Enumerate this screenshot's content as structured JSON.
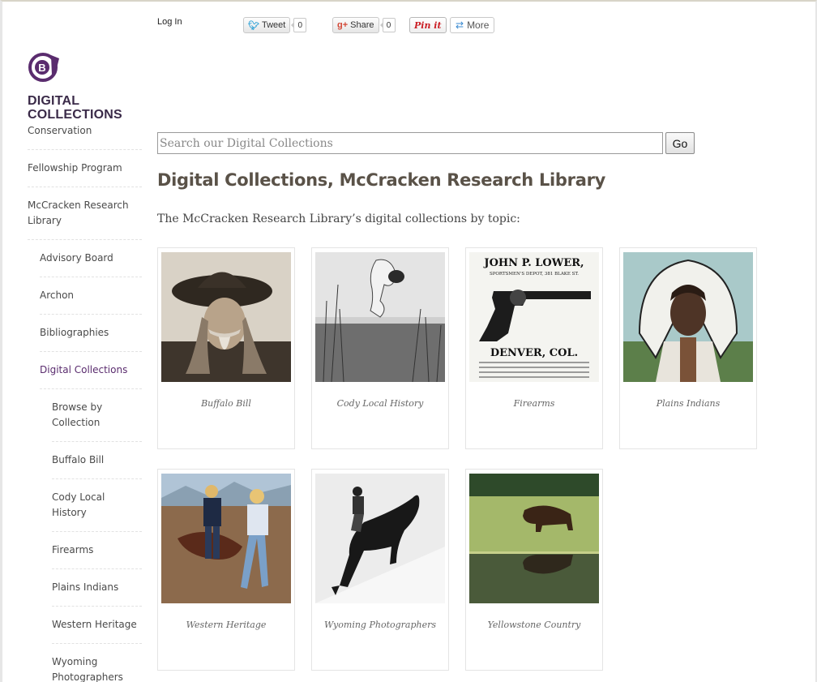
{
  "header": {
    "login_label": "Log In"
  },
  "social": {
    "tweet_label": "Tweet",
    "tweet_count": "0",
    "share_label": "Share",
    "share_count": "0",
    "pin_label": "Pin it",
    "more_label": "More"
  },
  "brand": {
    "line1": "DIGITAL",
    "line2": "COLLECTIONS",
    "color": "#3a2a48"
  },
  "sidebar": {
    "items": [
      {
        "label": "Conservation"
      },
      {
        "label": "Fellowship Program"
      },
      {
        "label": "McCracken Research Library"
      },
      {
        "label": "Advisory Board"
      },
      {
        "label": "Archon"
      },
      {
        "label": "Bibliographies"
      },
      {
        "label": "Digital Collections"
      },
      {
        "label": "Browse by Collection"
      },
      {
        "label": "Buffalo Bill"
      },
      {
        "label": "Cody Local History"
      },
      {
        "label": "Firearms"
      },
      {
        "label": "Plains Indians"
      },
      {
        "label": "Western Heritage"
      },
      {
        "label": "Wyoming Photographers"
      }
    ]
  },
  "search": {
    "placeholder": "Search our Digital Collections",
    "value": "",
    "button_label": "Go"
  },
  "main": {
    "title": "Digital Collections, McCracken Research Library",
    "intro": "The McCracken Research Library’s digital collections by topic:",
    "collections": [
      {
        "caption": "Buffalo Bill"
      },
      {
        "caption": "Cody Local History"
      },
      {
        "caption": "Firearms",
        "ad_line1": "JOHN P. LOWER,",
        "ad_line2": "SPORTSMEN'S DEPOT, 381 BLAKE ST.",
        "ad_line3": "DENVER, COL."
      },
      {
        "caption": "Plains Indians"
      },
      {
        "caption": "Western Heritage"
      },
      {
        "caption": "Wyoming Photographers"
      },
      {
        "caption": "Yellowstone Country"
      }
    ]
  }
}
